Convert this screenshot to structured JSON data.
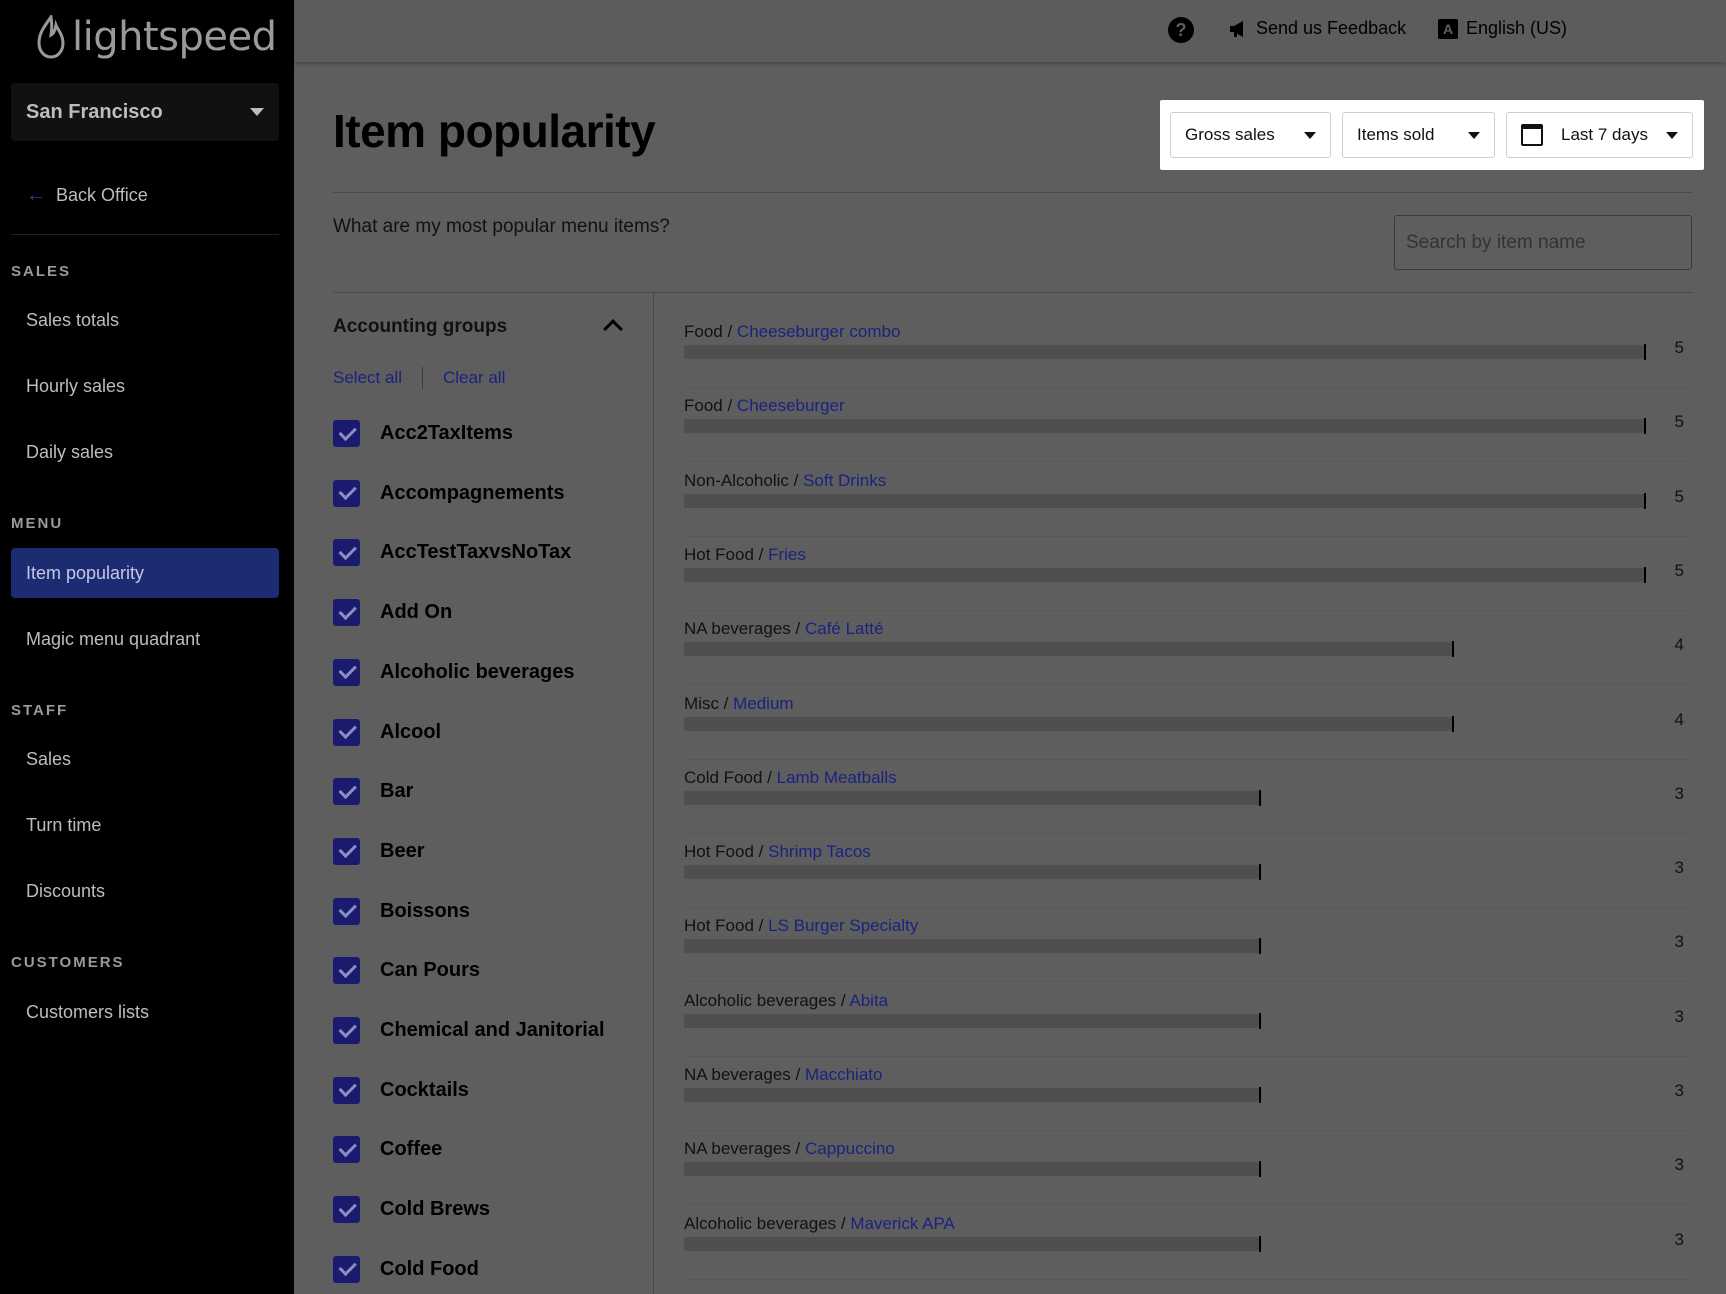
{
  "brand": {
    "name": "lightspeed"
  },
  "sidebar": {
    "location": "San Francisco",
    "back_office": "Back Office",
    "sections": [
      {
        "title": "SALES",
        "items": [
          "Sales totals",
          "Hourly sales",
          "Daily sales"
        ]
      },
      {
        "title": "MENU",
        "items": [
          "Item popularity",
          "Magic menu quadrant"
        ]
      },
      {
        "title": "STAFF",
        "items": [
          "Sales",
          "Turn time",
          "Discounts"
        ]
      },
      {
        "title": "CUSTOMERS",
        "items": [
          "Customers lists"
        ]
      }
    ],
    "active_item": "Item popularity"
  },
  "topbar": {
    "help": "?",
    "feedback": "Send us Feedback",
    "language": "English (US)"
  },
  "page": {
    "title": "Item popularity",
    "subtitle": "What are my most popular menu items?",
    "search_placeholder": "Search by item name"
  },
  "filters": {
    "metric": "Gross sales",
    "sort": "Items sold",
    "period": "Last 7 days"
  },
  "accounting_groups": {
    "title": "Accounting groups",
    "select_all": "Select all",
    "clear_all": "Clear all",
    "groups": [
      {
        "name": "Acc2TaxItems",
        "checked": true
      },
      {
        "name": "Accompagnements",
        "checked": true
      },
      {
        "name": "AccTestTaxvsNoTax",
        "checked": true
      },
      {
        "name": "Add On",
        "checked": true
      },
      {
        "name": "Alcoholic beverages",
        "checked": true
      },
      {
        "name": "Alcool",
        "checked": true
      },
      {
        "name": "Bar",
        "checked": true
      },
      {
        "name": "Beer",
        "checked": true
      },
      {
        "name": "Boissons",
        "checked": true
      },
      {
        "name": "Can Pours",
        "checked": true
      },
      {
        "name": "Chemical and Janitorial",
        "checked": true
      },
      {
        "name": "Cocktails",
        "checked": true
      },
      {
        "name": "Coffee",
        "checked": true
      },
      {
        "name": "Cold Brews",
        "checked": true
      },
      {
        "name": "Cold Food",
        "checked": true
      }
    ]
  },
  "items": {
    "max": 5,
    "rows": [
      {
        "group": "Food /",
        "name": "Cheeseburger combo",
        "value": 5
      },
      {
        "group": "Food /",
        "name": "Cheeseburger",
        "value": 5
      },
      {
        "group": "Non-Alcoholic /",
        "name": "Soft Drinks",
        "value": 5
      },
      {
        "group": "Hot Food /",
        "name": "Fries",
        "value": 5
      },
      {
        "group": "NA beverages /",
        "name": "Café Latté",
        "value": 4
      },
      {
        "group": "Misc /",
        "name": "Medium",
        "value": 4
      },
      {
        "group": "Cold Food /",
        "name": "Lamb Meatballs",
        "value": 3
      },
      {
        "group": "Hot Food /",
        "name": "Shrimp Tacos",
        "value": 3
      },
      {
        "group": "Hot Food /",
        "name": "LS Burger Specialty",
        "value": 3
      },
      {
        "group": "Alcoholic beverages /",
        "name": "Abita",
        "value": 3
      },
      {
        "group": "NA beverages /",
        "name": "Macchiato",
        "value": 3
      },
      {
        "group": "NA beverages /",
        "name": "Cappuccino",
        "value": 3
      },
      {
        "group": "Alcoholic beverages /",
        "name": "Maverick APA",
        "value": 3
      }
    ]
  },
  "colors": {
    "accent": "#1d2b73",
    "link": "#1a237e",
    "checkbox": "#1a1b6e"
  }
}
